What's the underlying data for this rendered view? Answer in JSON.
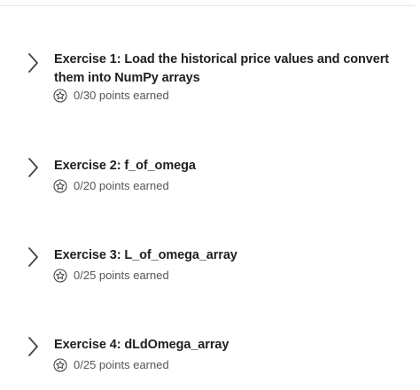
{
  "exercises": [
    {
      "title": "Exercise 1: Load the historical price values and convert them into NumPy arrays",
      "points": "0/30 points earned"
    },
    {
      "title": "Exercise 2: f_of_omega",
      "points": "0/20 points earned"
    },
    {
      "title": "Exercise 3: L_of_omega_array",
      "points": "0/25 points earned"
    },
    {
      "title": "Exercise 4: dLdOmega_array",
      "points": "0/25 points earned"
    }
  ],
  "icons": {
    "expand": "chevron-right-icon",
    "points": "star-badge-icon"
  },
  "colors": {
    "title_text": "#1f1f1f",
    "meta_text": "#555555",
    "icon": "#444444",
    "divider": "#e5e5e5"
  }
}
